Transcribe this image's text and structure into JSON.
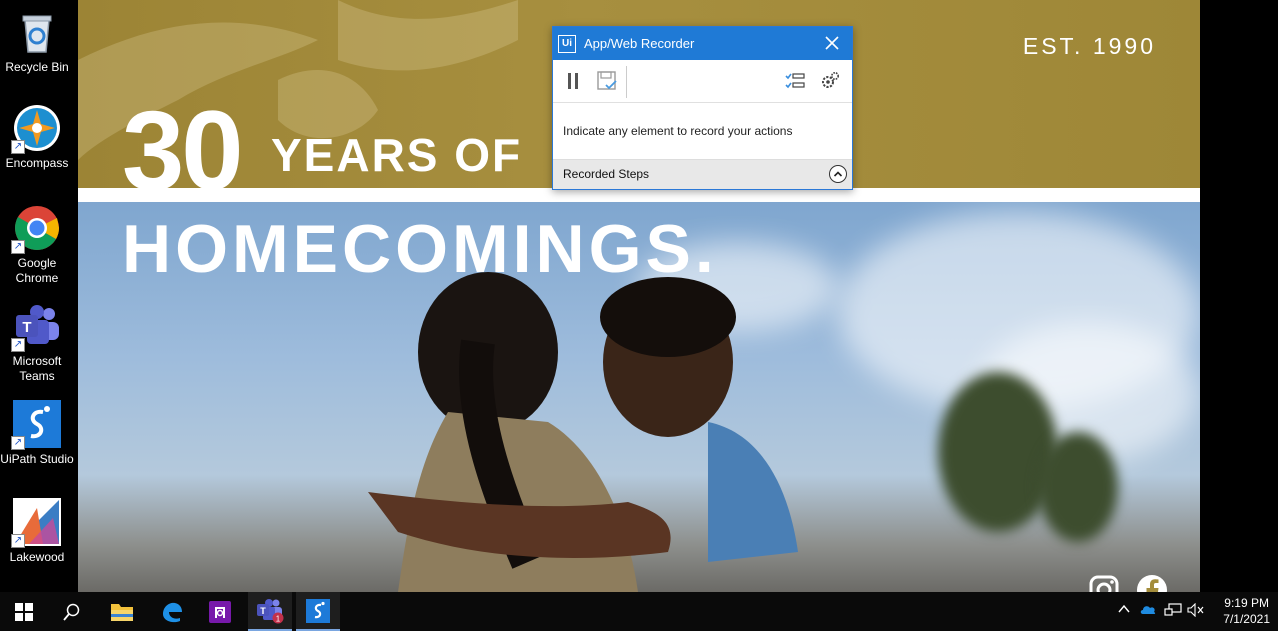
{
  "desktop": {
    "icons": [
      {
        "label": "Recycle Bin",
        "icon": "recycle-bin-icon"
      },
      {
        "label": "Encompass",
        "icon": "encompass-icon"
      },
      {
        "label": "Google Chrome",
        "icon": "chrome-icon"
      },
      {
        "label": "Microsoft Teams",
        "icon": "teams-icon"
      },
      {
        "label": "UiPath Studio",
        "icon": "uipath-icon"
      },
      {
        "label": "Lakewood",
        "icon": "lakewood-icon"
      }
    ]
  },
  "website": {
    "est": "EST. 1990",
    "headline_number": "30",
    "headline_line1": "YEARS OF",
    "headline_line2": "HOMECOMINGS.",
    "social": [
      "instagram-icon",
      "facebook-icon"
    ],
    "colors": {
      "gold": "#a38c3b",
      "white": "#ffffff"
    }
  },
  "recorder": {
    "title": "App/Web Recorder",
    "logo": "Ui",
    "message": "Indicate any element to record your actions",
    "steps_label": "Recorded Steps",
    "accent": "#1f7ad6"
  },
  "taskbar": {
    "apps": [
      "start-icon",
      "search-icon",
      "file-explorer-icon",
      "edge-icon",
      "onenote-icon",
      "teams-icon",
      "uipath-icon"
    ],
    "teams_badge": "1",
    "time": "9:19 PM",
    "date": "7/1/2021"
  }
}
